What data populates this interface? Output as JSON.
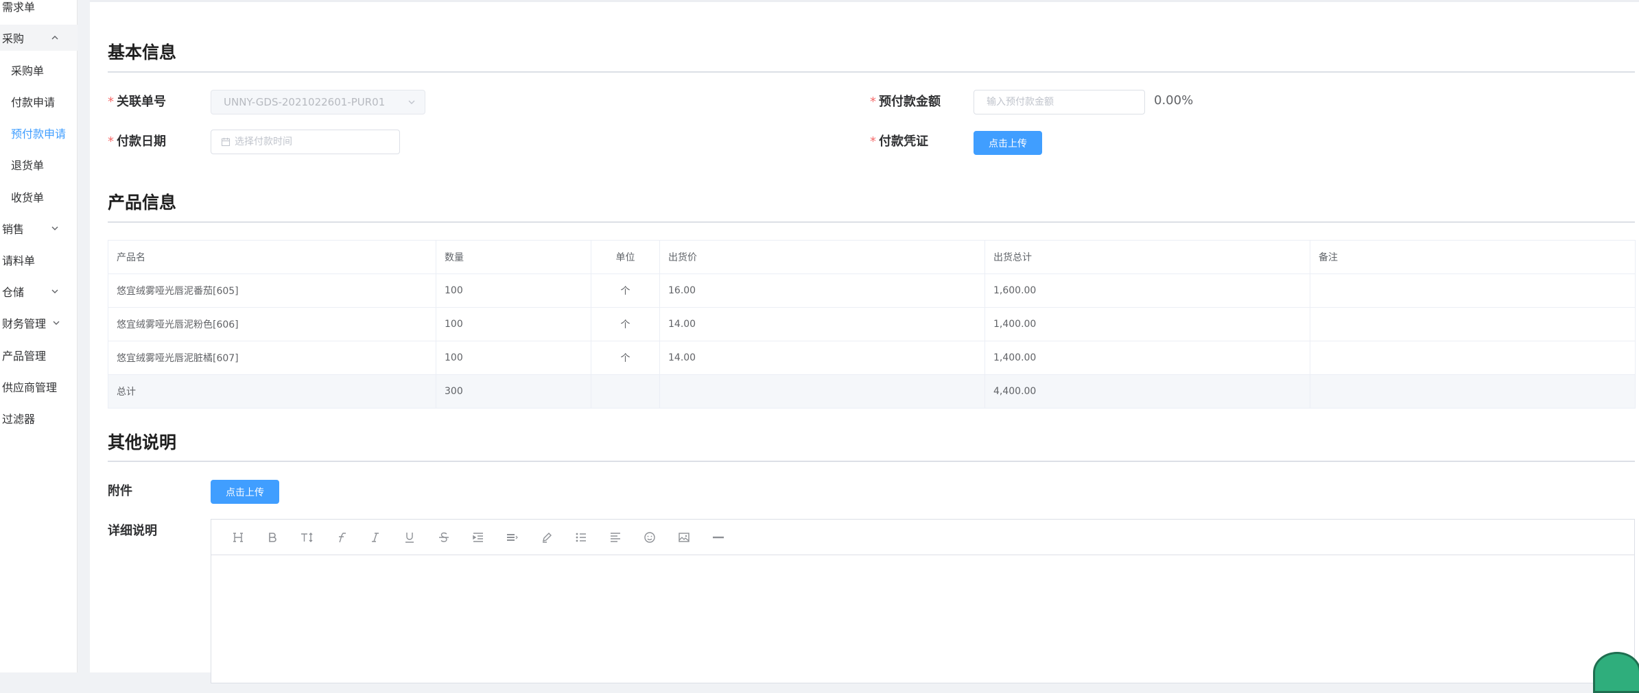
{
  "sidebar": {
    "items": [
      {
        "label": "需求单",
        "level": "top"
      },
      {
        "label": "采购",
        "level": "top",
        "expanded": true
      },
      {
        "label": "采购单",
        "level": "sub"
      },
      {
        "label": "付款申请",
        "level": "sub"
      },
      {
        "label": "预付款申请",
        "level": "sub",
        "active": true
      },
      {
        "label": "退货单",
        "level": "sub"
      },
      {
        "label": "收货单",
        "level": "sub"
      },
      {
        "label": "销售",
        "level": "top",
        "expanded": false
      },
      {
        "label": "请料单",
        "level": "top"
      },
      {
        "label": "仓储",
        "level": "top",
        "expanded": false
      },
      {
        "label": "财务管理",
        "level": "top",
        "expanded": false
      },
      {
        "label": "产品管理",
        "level": "top"
      },
      {
        "label": "供应商管理",
        "level": "top"
      },
      {
        "label": "过滤器",
        "level": "top"
      }
    ],
    "active_color": "#409eff"
  },
  "basic_info": {
    "title": "基本信息",
    "related_order_label": "关联单号",
    "related_order_value": "UNNY-GDS-2021022601-PUR01",
    "payment_date_label": "付款日期",
    "payment_date_placeholder": "选择付款时间",
    "prepay_amount_label": "预付款金额",
    "prepay_amount_placeholder": "输入预付款金额",
    "prepay_percent": "0.00%",
    "voucher_label": "付款凭证",
    "upload_label": "点击上传",
    "required_mark": "*"
  },
  "product_info": {
    "title": "产品信息",
    "columns": [
      "产品名",
      "数量",
      "单位",
      "出货价",
      "出货总计",
      "备注"
    ],
    "rows": [
      [
        "悠宜绒雾哑光唇泥番茄[605]",
        "100",
        "个",
        "16.00",
        "1,600.00",
        ""
      ],
      [
        "悠宜绒雾哑光唇泥粉色[606]",
        "100",
        "个",
        "14.00",
        "1,400.00",
        ""
      ],
      [
        "悠宜绒雾哑光唇泥脏橘[607]",
        "100",
        "个",
        "14.00",
        "1,400.00",
        ""
      ]
    ],
    "total_row": [
      "总计",
      "300",
      "",
      "",
      "4,400.00",
      ""
    ]
  },
  "other_info": {
    "title": "其他说明",
    "attachment_label": "附件",
    "upload_label": "点击上传",
    "detail_label": "详细说明",
    "toolbar": [
      "heading-icon",
      "bold-icon",
      "font-size-icon",
      "font-family-icon",
      "italic-icon",
      "underline-icon",
      "strikethrough-icon",
      "indent-icon",
      "line-height-icon",
      "color-icon",
      "list-icon",
      "align-icon",
      "emoji-icon",
      "image-icon",
      "divider-icon"
    ]
  },
  "colors": {
    "primary": "#409eff",
    "required": "#f56c6c"
  }
}
